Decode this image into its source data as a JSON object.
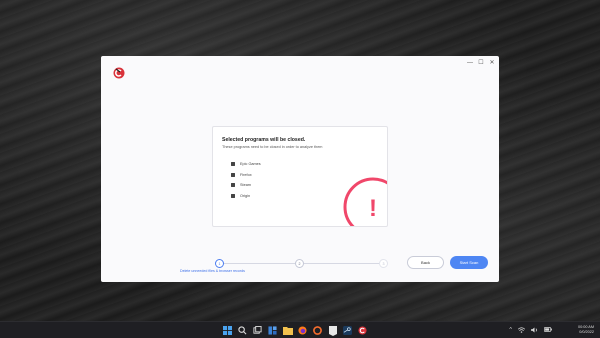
{
  "app": {
    "window_controls": {
      "minimize": "—",
      "maximize": "☐",
      "close": "✕"
    },
    "accent_color": "#4e86f3",
    "warning_color": "#f0476a"
  },
  "dialog": {
    "title": "Selected programs will be closed.",
    "subtitle": "These programs need to be closed in order to analyze them",
    "programs": [
      {
        "name": "Epic Games",
        "icon": "epic-games-icon"
      },
      {
        "name": "Firefox",
        "icon": "firefox-icon"
      },
      {
        "name": "Steam",
        "icon": "steam-icon"
      },
      {
        "name": "Origin",
        "icon": "origin-icon"
      }
    ],
    "warning_glyph": "!"
  },
  "stepper": {
    "steps": [
      "1",
      "2",
      "3"
    ],
    "active_step": 1,
    "caption": "Delete unneeded files & browser records"
  },
  "buttons": {
    "back": "Back",
    "start_scan": "Start Scan"
  },
  "taskbar": {
    "icons": [
      "windows-start-icon",
      "search-icon",
      "task-view-icon",
      "widgets-icon",
      "file-explorer-icon",
      "firefox-icon",
      "origin-icon",
      "epic-games-icon",
      "steam-icon",
      "ccleaner-icon"
    ],
    "tray": {
      "chevron": "^",
      "wifi": "wifi",
      "volume": "volume",
      "battery": "battery"
    },
    "time": "00:00 AM",
    "date": "0/0/2022"
  }
}
